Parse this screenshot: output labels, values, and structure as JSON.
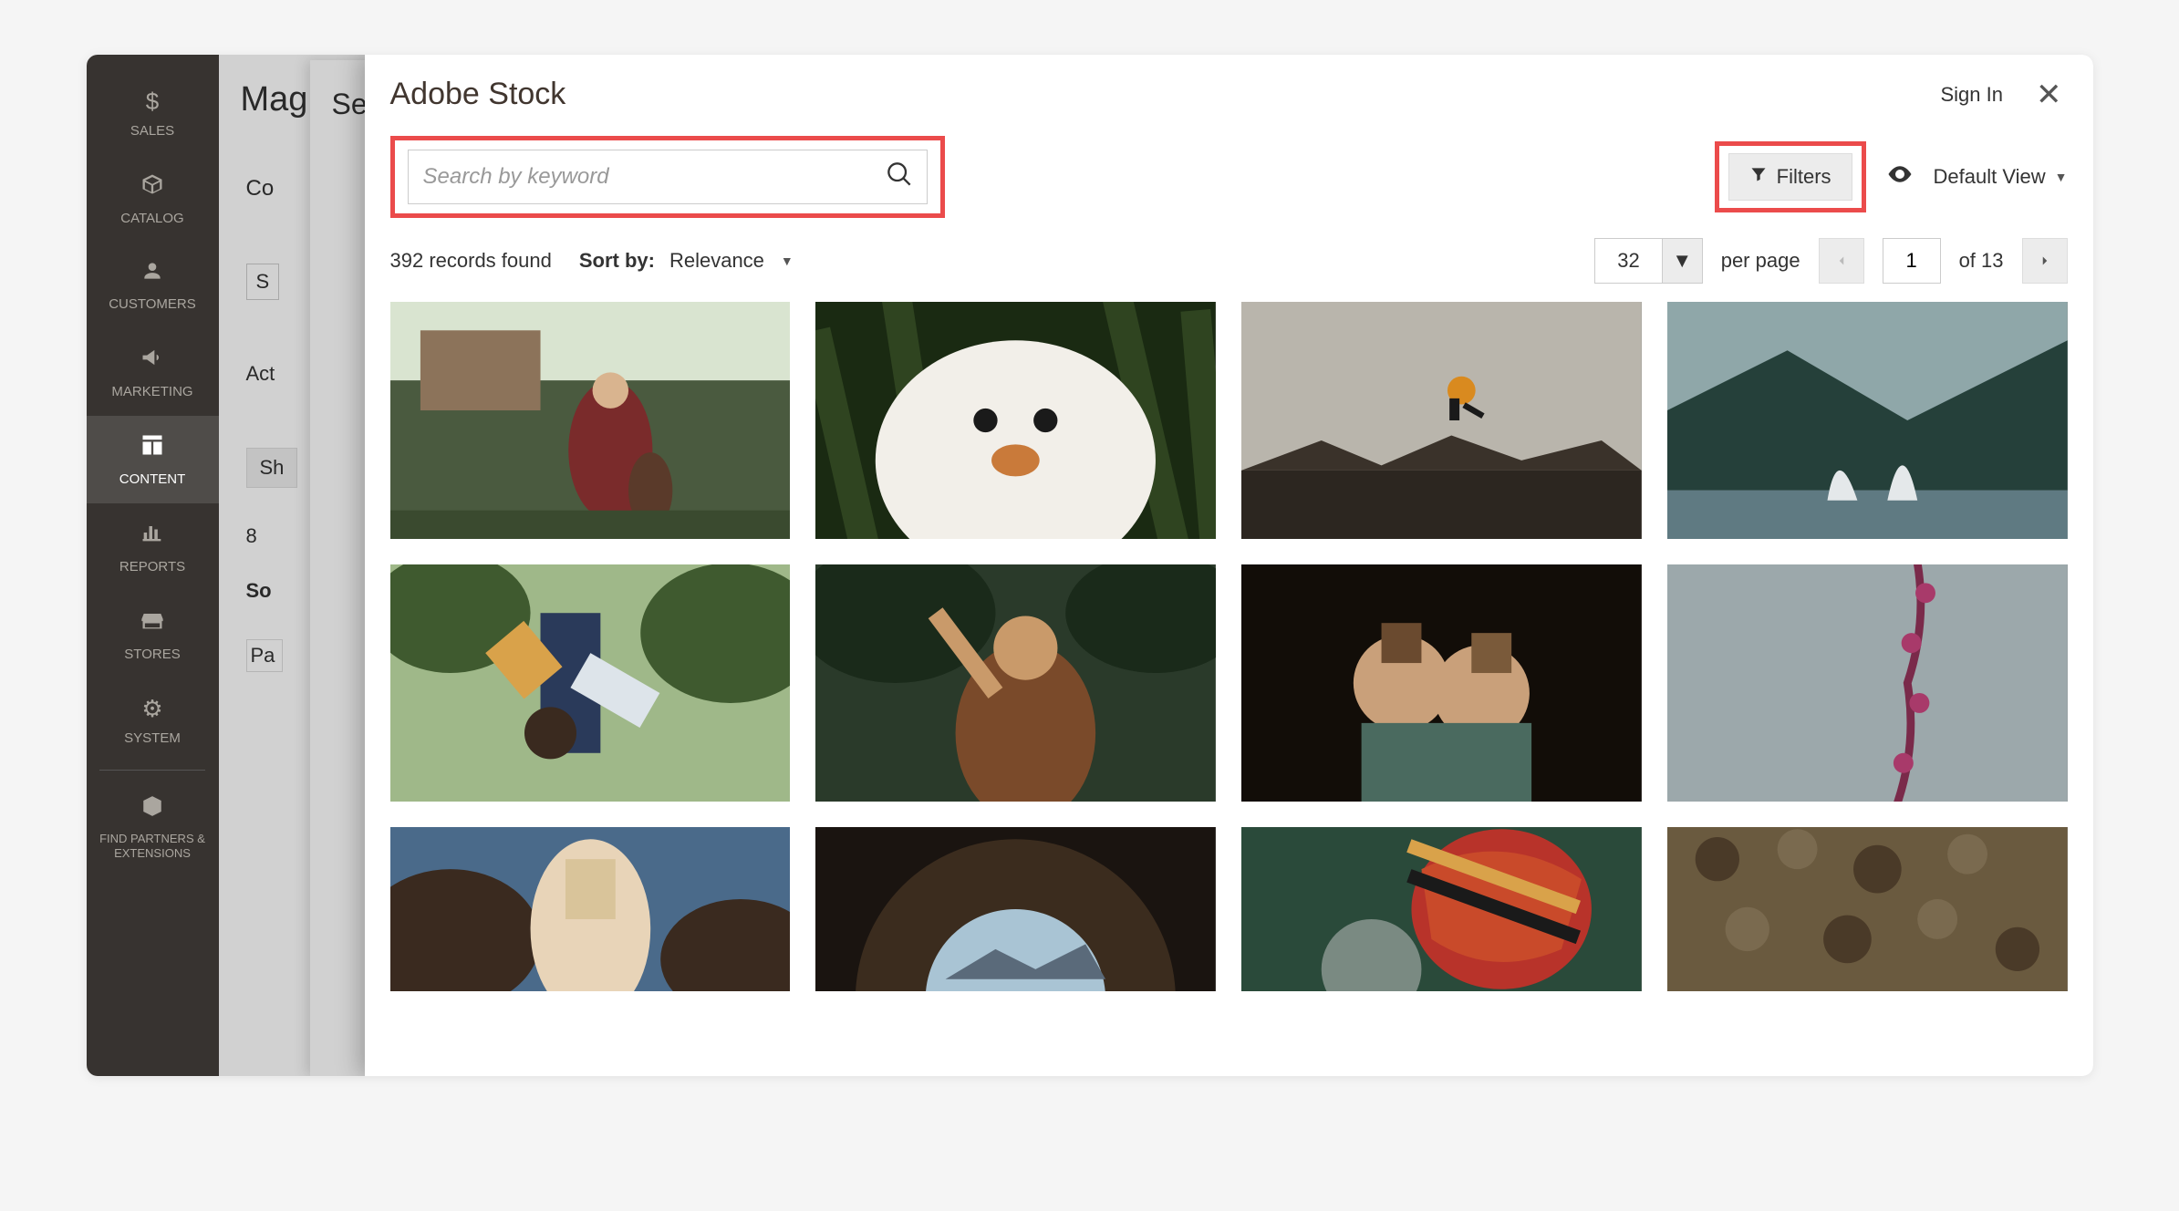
{
  "sidebar": {
    "items": [
      {
        "label": "SALES",
        "icon": "dollar"
      },
      {
        "label": "CATALOG",
        "icon": "box"
      },
      {
        "label": "CUSTOMERS",
        "icon": "person"
      },
      {
        "label": "MARKETING",
        "icon": "megaphone"
      },
      {
        "label": "CONTENT",
        "icon": "layout"
      },
      {
        "label": "REPORTS",
        "icon": "bars"
      },
      {
        "label": "STORES",
        "icon": "storefront"
      },
      {
        "label": "SYSTEM",
        "icon": "gear"
      },
      {
        "label": "FIND PARTNERS & EXTENSIONS",
        "icon": "package"
      }
    ],
    "active_index": 4
  },
  "background": {
    "panel1_heading": "Mag",
    "panel2_heading": "Se",
    "partial_rows": [
      "Co",
      "S",
      "Act",
      "Sh",
      "8",
      "So",
      "Pa"
    ]
  },
  "modal": {
    "title": "Adobe Stock",
    "sign_in": "Sign In",
    "search": {
      "placeholder": "Search by keyword"
    },
    "filters_label": "Filters",
    "default_view_label": "Default View",
    "records_found": "392 records found",
    "sort_by_label": "Sort by:",
    "sort_by_value": "Relevance",
    "per_page_value": "32",
    "per_page_label": "per page",
    "page_current": "1",
    "page_of_label": "of 13"
  }
}
